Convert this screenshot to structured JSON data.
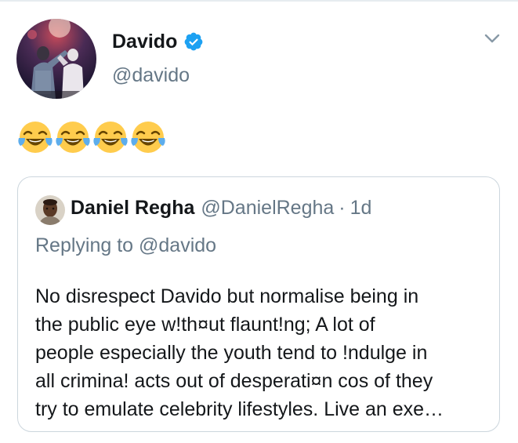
{
  "tweet": {
    "author": {
      "display_name": "Davido",
      "handle": "@davido",
      "verified": true,
      "verified_icon": "verified-badge-icon",
      "verified_color": "#1da1f2"
    },
    "menu_icon": "chevron-down-icon",
    "body_emojis": [
      "face-with-tears-of-joy-emoji",
      "face-with-tears-of-joy-emoji",
      "face-with-tears-of-joy-emoji",
      "face-with-tears-of-joy-emoji"
    ]
  },
  "quote": {
    "author": {
      "display_name": "Daniel Regha",
      "handle": "@DanielRegha",
      "separator": "·",
      "timestamp": "1d"
    },
    "replying_to": "Replying to @davido",
    "text_lines": [
      "No disrespect Davido but normalise being in",
      "the public eye w!th¤ut flaunt!ng; A lot of",
      "people especially the youth tend to !ndulge in",
      "all crimina! acts out of desperati¤n cos of they",
      "try to emulate celebrity lifestyles. Live an exe…"
    ]
  },
  "colors": {
    "primary_text": "#14171a",
    "secondary_text": "#657786",
    "border": "#ccd6dd",
    "accent": "#1da1f2"
  }
}
